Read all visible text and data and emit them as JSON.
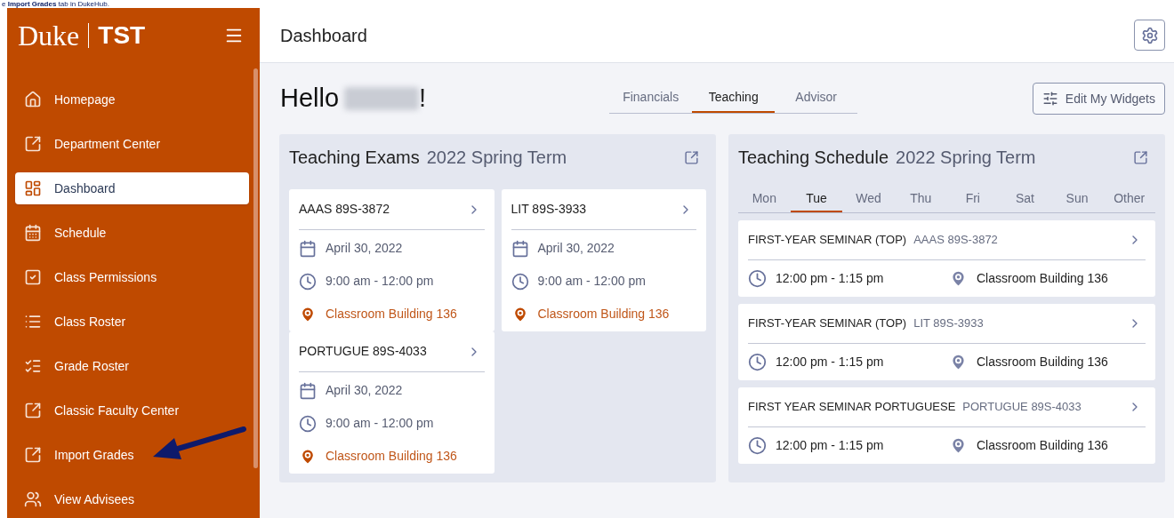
{
  "caption": "e **Import Grades** tab in DukeHub.",
  "sidebar": {
    "logo": "Duke",
    "logo_suffix": "TST",
    "items": [
      {
        "label": "Homepage",
        "selected": false
      },
      {
        "label": "Department Center",
        "selected": false
      },
      {
        "label": "Dashboard",
        "selected": true
      },
      {
        "label": "Schedule",
        "selected": false
      },
      {
        "label": "Class Permissions",
        "selected": false
      },
      {
        "label": "Class Roster",
        "selected": false
      },
      {
        "label": "Grade Roster",
        "selected": false
      },
      {
        "label": "Classic Faculty Center",
        "selected": false
      },
      {
        "label": "Import Grades",
        "selected": false
      },
      {
        "label": "View Advisees",
        "selected": false
      }
    ]
  },
  "header": {
    "title": "Dashboard"
  },
  "greeting": {
    "hello": "Hello",
    "end": "!"
  },
  "tabs": [
    {
      "label": "Financials",
      "selected": false
    },
    {
      "label": "Teaching",
      "selected": true
    },
    {
      "label": "Advisor",
      "selected": false
    }
  ],
  "edit_button": "Edit My Widgets",
  "exams": {
    "title": "Teaching Exams",
    "term": "2022 Spring Term",
    "cards": [
      {
        "course": "AAAS 89S-3872",
        "date": "April 30, 2022",
        "time": "9:00 am - 12:00 pm",
        "location": "Classroom Building 136"
      },
      {
        "course": "LIT 89S-3933",
        "date": "April 30, 2022",
        "time": "9:00 am - 12:00 pm",
        "location": "Classroom Building 136"
      },
      {
        "course": "PORTUGUE 89S-4033",
        "date": "April 30, 2022",
        "time": "9:00 am - 12:00 pm",
        "location": "Classroom Building 136"
      }
    ]
  },
  "schedule": {
    "title": "Teaching Schedule",
    "term": "2022 Spring Term",
    "days": [
      {
        "label": "Mon",
        "selected": false
      },
      {
        "label": "Tue",
        "selected": true
      },
      {
        "label": "Wed",
        "selected": false
      },
      {
        "label": "Thu",
        "selected": false
      },
      {
        "label": "Fri",
        "selected": false
      },
      {
        "label": "Sat",
        "selected": false
      },
      {
        "label": "Sun",
        "selected": false
      },
      {
        "label": "Other",
        "selected": false
      }
    ],
    "classes": [
      {
        "name": "FIRST-YEAR SEMINAR (TOP)",
        "course": "AAAS 89S-3872",
        "time": "12:00 pm - 1:15 pm",
        "location": "Classroom Building 136"
      },
      {
        "name": "FIRST-YEAR SEMINAR (TOP)",
        "course": "LIT 89S-3933",
        "time": "12:00 pm - 1:15 pm",
        "location": "Classroom Building 136"
      },
      {
        "name": "FIRST YEAR SEMINAR PORTUGUESE",
        "course": "PORTUGUE 89S-4033",
        "time": "12:00 pm - 1:15 pm",
        "location": "Classroom Building 136"
      }
    ]
  }
}
